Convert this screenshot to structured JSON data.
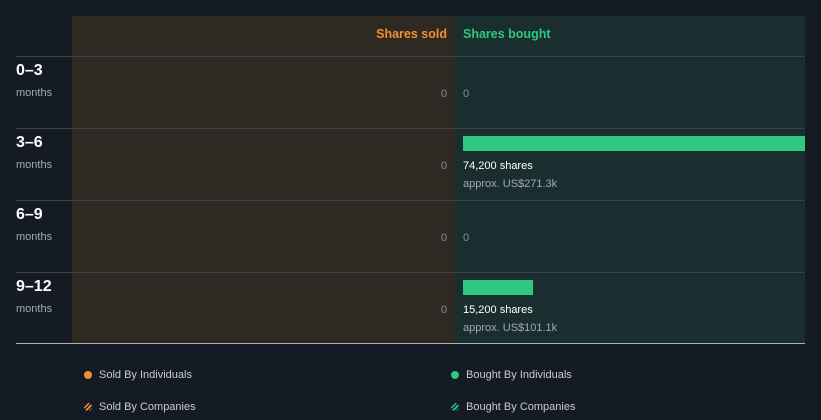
{
  "chart_data": {
    "type": "bar",
    "orientation": "horizontal-diverging",
    "columns": {
      "sold": "Shares sold",
      "bought": "Shares bought"
    },
    "categories": [
      {
        "range": "0–3",
        "unit": "months"
      },
      {
        "range": "3–6",
        "unit": "months"
      },
      {
        "range": "6–9",
        "unit": "months"
      },
      {
        "range": "9–12",
        "unit": "months"
      }
    ],
    "series": [
      {
        "name": "Shares sold",
        "values": [
          0,
          0,
          0,
          0
        ]
      },
      {
        "name": "Shares bought",
        "values": [
          0,
          74200,
          0,
          15200
        ]
      }
    ],
    "rows": [
      {
        "sold_text": "0",
        "bought_text": "0",
        "shares_text": "",
        "approx_text": ""
      },
      {
        "sold_text": "0",
        "bought_text": "",
        "shares_text": "74,200 shares",
        "approx_text": "approx. US$271.3k"
      },
      {
        "sold_text": "0",
        "bought_text": "0",
        "shares_text": "",
        "approx_text": ""
      },
      {
        "sold_text": "0",
        "bought_text": "",
        "shares_text": "15,200 shares",
        "approx_text": "approx. US$101.1k"
      }
    ],
    "legend": [
      {
        "label": "Sold By Individuals",
        "marker": "dot",
        "color": "#f2912e"
      },
      {
        "label": "Bought By Individuals",
        "marker": "dot",
        "color": "#2dc97e"
      },
      {
        "label": "Sold By Companies",
        "marker": "hatch",
        "color": "#f2912e"
      },
      {
        "label": "Bought By Companies",
        "marker": "hatch",
        "color": "#2dc97e"
      }
    ],
    "legend_position": "bottom",
    "colors": {
      "background": "#151b24",
      "sold_panel": "#2e2922",
      "bought_panel": "#1a2d2f",
      "sold_accent": "#f2912e",
      "bought_accent": "#2dc97e",
      "gridline": "#3a4148"
    }
  }
}
